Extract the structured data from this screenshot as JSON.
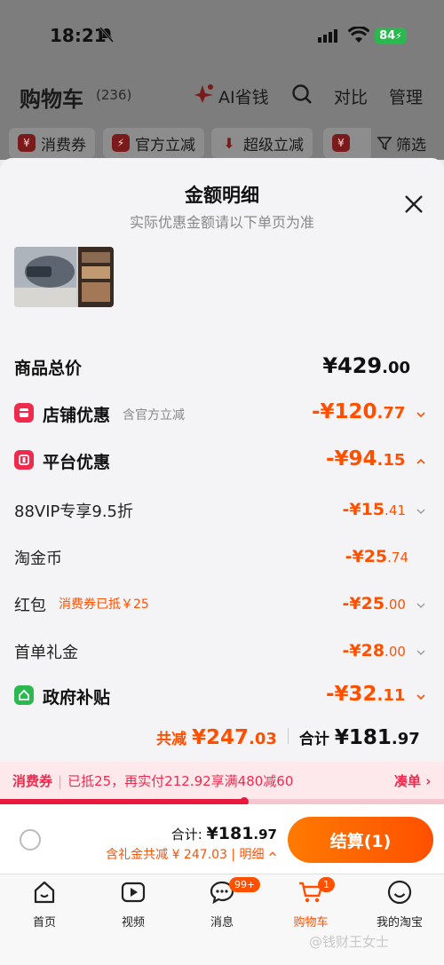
{
  "status_bar": {
    "time": "18:21",
    "battery": "84"
  },
  "header": {
    "title": "购物车",
    "count": "(236)",
    "ai_label": "AI省钱",
    "compare": "对比",
    "manage": "管理"
  },
  "filters": [
    {
      "label": "消费券"
    },
    {
      "label": "官方立减"
    },
    {
      "label": "超级立减"
    }
  ],
  "filter_button": "筛选",
  "sheet": {
    "title": "金额明细",
    "subtitle": "实际优惠金额请以下单页为准"
  },
  "rows": {
    "total": {
      "label": "商品总价",
      "int": "¥429",
      "dec": ".00"
    },
    "shop": {
      "label": "店铺优惠",
      "tag": "含官方立减",
      "int": "-¥120",
      "dec": ".77"
    },
    "platform": {
      "label": "平台优惠",
      "int": "-¥94",
      "dec": ".15"
    },
    "vip": {
      "label": "88VIP专享9.5折",
      "int": "-¥15",
      "dec": ".41"
    },
    "coin": {
      "label": "淘金币",
      "int": "-¥25",
      "dec": ".74"
    },
    "redpack": {
      "label": "红包",
      "tag": "消费券已抵￥25",
      "int": "-¥25",
      "dec": ".00"
    },
    "firstorder": {
      "label": "首单礼金",
      "int": "-¥28",
      "dec": ".00"
    },
    "gov": {
      "label": "政府补贴",
      "int": "-¥32",
      "dec": ".11"
    }
  },
  "summary": {
    "discount_label": "共减",
    "discount_int": "¥247",
    "discount_dec": ".03",
    "total_label": "合计",
    "total_int": "¥181",
    "total_dec": ".97"
  },
  "coupon_bar": {
    "label": "消费券",
    "text": "已抵25，再实付212.92享满480减60",
    "link": "凑单",
    "progress": 0.55
  },
  "checkout": {
    "total_label": "合计:",
    "total_int": "¥181",
    "total_dec": ".97",
    "discount_text": "含礼金共减 ¥ 247.03 | 明细",
    "button": "结算(1)"
  },
  "tabs": [
    {
      "label": "首页",
      "icon": "home-icon"
    },
    {
      "label": "视频",
      "icon": "video-icon"
    },
    {
      "label": "消息",
      "icon": "message-icon",
      "badge": "99+"
    },
    {
      "label": "购物车",
      "icon": "cart-icon",
      "badge": "1"
    },
    {
      "label": "我的淘宝",
      "icon": "profile-icon"
    }
  ],
  "watermark": "@钱财王女士",
  "colors": {
    "accent": "#ff5000",
    "pink": "#ee2a4d",
    "green": "#2bb94f"
  }
}
